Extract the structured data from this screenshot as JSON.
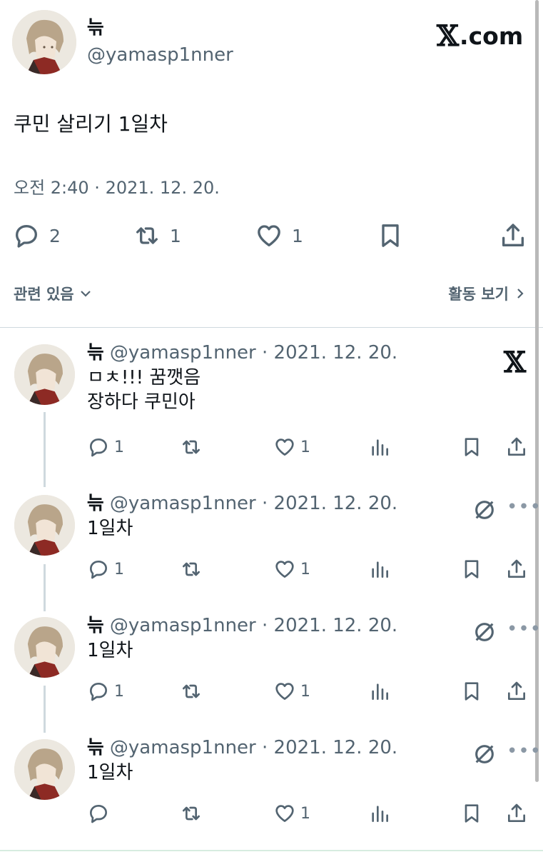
{
  "main": {
    "author_name": "늒",
    "author_handle": "@yamasp1nner",
    "brand": ".com",
    "text": "쿠민 살리기 1일차",
    "timestamp": "오전 2:40 · 2021. 12. 20.",
    "replies_count": "2",
    "retweets_count": "1",
    "likes_count": "1",
    "related_link": "관련 있음",
    "activity_link": "활동 보기"
  },
  "replies": [
    {
      "name": "늒",
      "meta": "@yamasp1nner · 2021. 12. 20.",
      "line1": "ㅁㅊ!!! 꿈깻음",
      "line2": "장하다 쿠민아",
      "replies": "1",
      "likes": "1"
    },
    {
      "name": "늒",
      "meta": "@yamasp1nner · 2021. 12. 20.",
      "line1": "1일차",
      "replies": "1",
      "likes": "1"
    },
    {
      "name": "늒",
      "meta": "@yamasp1nner · 2021. 12. 20.",
      "line1": "1일차",
      "replies": "1",
      "likes": "1"
    },
    {
      "name": "늒",
      "meta": "@yamasp1nner · 2021. 12. 20.",
      "line1": "1일차",
      "likes": "1"
    }
  ],
  "icons": {
    "reply": "speech-bubble-icon",
    "retweet": "retweet-icon",
    "like": "heart-icon",
    "views": "bar-chart-icon",
    "bookmark": "bookmark-icon",
    "share": "share-icon",
    "x_logo": "x-logo-icon",
    "hidden": "slash-circle-icon",
    "more": "more-dots-icon"
  },
  "colors": {
    "text": "#0f1419",
    "secondary": "#536471",
    "divider": "#cfd9de"
  }
}
